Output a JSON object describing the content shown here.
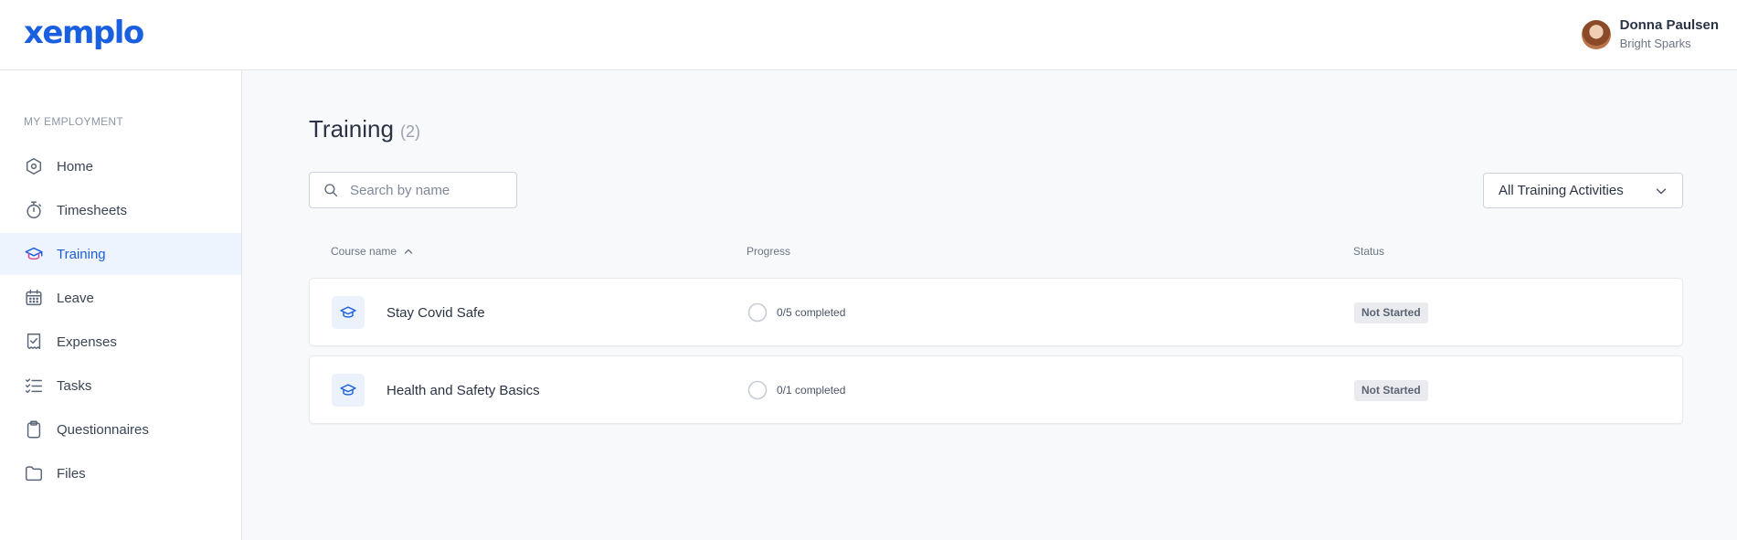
{
  "header": {
    "logo_text": "xemplo",
    "user": {
      "name": "Donna Paulsen",
      "org": "Bright Sparks",
      "avatar_icon": "avatar"
    }
  },
  "sidebar": {
    "section": "MY EMPLOYMENT",
    "items": [
      {
        "label": "Home",
        "icon": "home-icon",
        "active": false
      },
      {
        "label": "Timesheets",
        "icon": "stopwatch-icon",
        "active": false
      },
      {
        "label": "Training",
        "icon": "graduation-cap-icon",
        "active": true
      },
      {
        "label": "Leave",
        "icon": "calendar-icon",
        "active": false
      },
      {
        "label": "Expenses",
        "icon": "receipt-icon",
        "active": false
      },
      {
        "label": "Tasks",
        "icon": "checklist-icon",
        "active": false
      },
      {
        "label": "Questionnaires",
        "icon": "clipboard-icon",
        "active": false
      },
      {
        "label": "Files",
        "icon": "folder-icon",
        "active": false
      }
    ]
  },
  "main": {
    "title": "Training",
    "count": "(2)",
    "search": {
      "placeholder": "Search by name",
      "value": ""
    },
    "filter": {
      "selected": "All Training Activities"
    },
    "columns": {
      "course": "Course name",
      "progress": "Progress",
      "status": "Status"
    },
    "rows": [
      {
        "course": "Stay Covid Safe",
        "progress": "0/5 completed",
        "status": "Not Started"
      },
      {
        "course": "Health and Safety Basics",
        "progress": "0/1 completed",
        "status": "Not Started"
      }
    ]
  },
  "colors": {
    "brand": "#1a5fe0",
    "active_bg": "#eef4fd",
    "badge_bg": "#e9ebef",
    "page_bg": "#f8f9fb"
  }
}
